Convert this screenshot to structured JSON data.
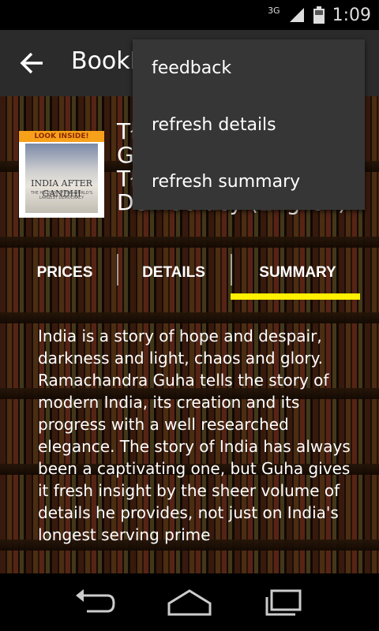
{
  "status_bar": {
    "network": "3G",
    "time": "1:09",
    "icons": [
      "signal-icon",
      "battery-icon"
    ]
  },
  "action_bar": {
    "title": "BookM",
    "back_icon": "arrow-back-icon"
  },
  "book": {
    "cover": {
      "banner": "LOOK INSIDE!",
      "title": "INDIA AFTER GANDHI",
      "subtitle": "THE HISTORY OF THE WORLD'S LARGEST DEMOCRACY"
    },
    "title_lines": [
      "Tł",
      "G",
      "Tł",
      "Democracy (English)"
    ]
  },
  "tabs": [
    {
      "label": "PRICES"
    },
    {
      "label": "DETAILS"
    },
    {
      "label": "SUMMARY",
      "selected": true
    }
  ],
  "summary_text": "India is a story of hope and despair, darkness and light, chaos and glory. Ramachandra Guha tells the story of modern India, its creation and its progress with a well researched elegance. The story of India has always been a captivating one, but Guha gives it fresh insight by the sheer volume of details he provides, not just on India's longest serving prime",
  "overflow_menu": {
    "items": [
      "feedback",
      "refresh details",
      "refresh summary"
    ]
  },
  "nav_bar": {
    "icons": [
      "back-nav-icon",
      "home-icon",
      "recents-icon"
    ]
  },
  "colors": {
    "accent": "#ffef00",
    "actionbar": "#2b2b2b",
    "menu": "#363636"
  }
}
